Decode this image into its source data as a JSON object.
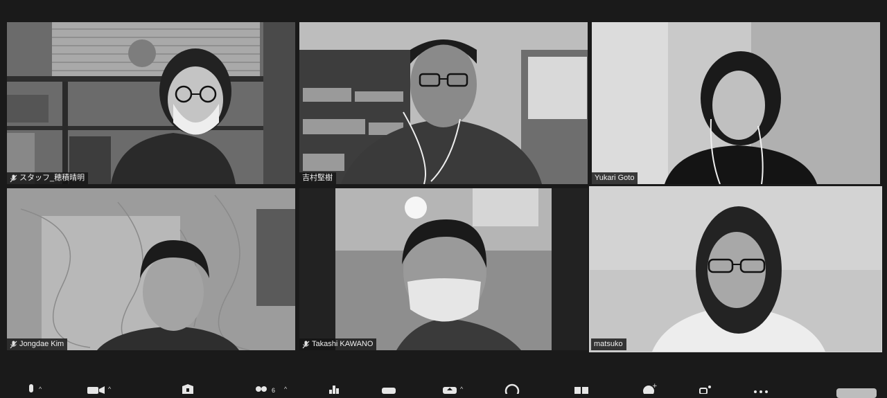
{
  "participants": [
    {
      "name": "スタッフ_穂積晴明",
      "muted": true
    },
    {
      "name": "吉村堅樹",
      "muted": false
    },
    {
      "name": "Yukari Goto",
      "muted": false
    },
    {
      "name": "Jongdae Kim",
      "muted": true
    },
    {
      "name": "Takashi KAWANO",
      "muted": true
    },
    {
      "name": "matsuko",
      "muted": false,
      "active_speaker": true
    }
  ],
  "toolbar": {
    "participant_count": "6",
    "items": [
      "microphone-icon",
      "video-camera-icon",
      "security-shield-icon",
      "participants-icon",
      "poll-chart-icon",
      "chat-icon",
      "share-screen-icon",
      "record-icon",
      "breakout-rooms-icon",
      "reactions-icon",
      "apps-icon",
      "more-icon"
    ]
  },
  "colors": {
    "background": "#1a1a1a",
    "tile": "#5a5a5a",
    "nametag": "#141414",
    "active_border": "#d8d8d8"
  }
}
